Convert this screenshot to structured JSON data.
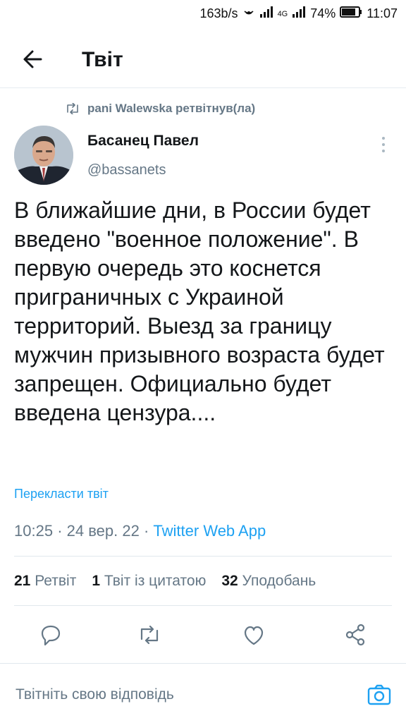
{
  "statusbar": {
    "speed": "163b/s",
    "network": "4G",
    "battery": "74%",
    "time": "11:07"
  },
  "header": {
    "title": "Твіт"
  },
  "retweet": {
    "label": "pani Walewska ретвітнув(ла)"
  },
  "author": {
    "name": "Басанец Павел",
    "handle": "@bassanets"
  },
  "tweet": {
    "text": "В ближайшие дни, в России будет введено \"военное положение\". В первую очередь это коснется приграничных с Украиной территорий. Выезд за границу мужчин призывного возраста будет запрещен. Официально будет введена цензура....",
    "translate_label": "Перекласти твіт",
    "time": "10:25",
    "date": "24 вер. 22",
    "app": "Twitter Web App"
  },
  "stats": {
    "retweets_count": "21",
    "retweets_label": "Ретвіт",
    "quotes_count": "1",
    "quotes_label": "Твіт із цитатою",
    "likes_count": "32",
    "likes_label": "Уподобань"
  },
  "reply": {
    "placeholder": "Твітніть свою відповідь"
  },
  "colors": {
    "accent": "#1da1f2",
    "secondary_text": "#657786"
  }
}
